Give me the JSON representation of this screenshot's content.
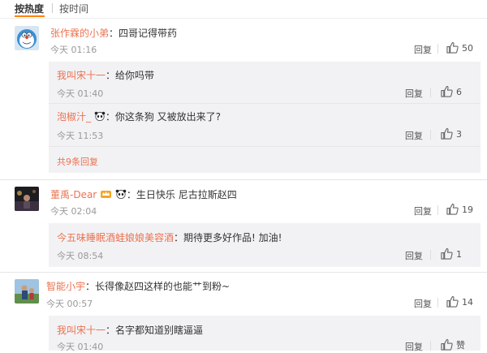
{
  "tabs": {
    "hot": "按热度",
    "time": "按时间"
  },
  "labels": {
    "reply": "回复",
    "like_text": "赞"
  },
  "comments": [
    {
      "name": "张作霖的小弟",
      "text": "：四哥记得带药",
      "time": "今天 01:16",
      "likes": "50",
      "replies": [
        {
          "name": "我叫宋十一",
          "text": "：给你吗带",
          "time": "今天 01:40",
          "likes": "6"
        },
        {
          "name": "泡椒汁_",
          "text": "：你这条狗 又被放出来了?",
          "time": "今天 11:53",
          "likes": "3"
        }
      ],
      "more_replies": "共9条回复"
    },
    {
      "name": "董禹-Dear",
      "text": "：生日快乐 尼古拉斯赵四",
      "time": "今天 02:04",
      "likes": "19",
      "replies": [
        {
          "name": "今五味睡眠酒蛙娘娘美容酒",
          "text": "：期待更多好作品! 加油!",
          "time": "今天 08:54",
          "likes": "1"
        }
      ]
    },
    {
      "name": "智能小宇",
      "text": "：长得像赵四这样的也能艹到粉~",
      "time": "今天 00:57",
      "likes": "14",
      "replies": [
        {
          "name": "我叫宋十一",
          "text": "：名字都知道别瞎逼逼",
          "time": "今天 01:40"
        }
      ]
    }
  ],
  "colors": {
    "accent": "#ff8200",
    "name": "#eb7350",
    "muted": "#999999",
    "reply_bg": "#f2f2f5"
  },
  "icons": {
    "like": "thumbs-up-icon",
    "emoji": "panda-emoji-icon",
    "badge": "crown-badge-icon"
  }
}
